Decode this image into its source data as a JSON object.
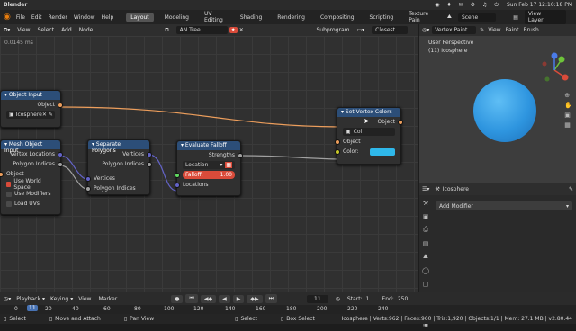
{
  "topbar": {
    "app_name": "Blender",
    "datetime": "Sun Feb 17 12:10:18 PM"
  },
  "menu": {
    "items": [
      "File",
      "Edit",
      "Render",
      "Window",
      "Help"
    ],
    "workspace_tabs": [
      "Layout",
      "Modeling",
      "UV Editing",
      "Shading",
      "Rendering",
      "Compositing",
      "Scripting",
      "Texture Pain"
    ],
    "active_tab": "Layout",
    "scene_label": "Scene",
    "view_layer_label": "View Layer"
  },
  "node_editor": {
    "header_items": [
      "View",
      "Select",
      "Add",
      "Node"
    ],
    "tree_name": "AN Tree",
    "subprogram_label": "Subprogram",
    "closest_label": "Closest",
    "timer": "0.0145 ms"
  },
  "nodes": {
    "object_input": {
      "title": "Object Input",
      "out_object": "Object",
      "object_value": "Icosphere"
    },
    "mesh_object_input": {
      "title": "Mesh Object Input",
      "out_vertex_locations": "Vertex Locations",
      "out_polygon_indices": "Polygon Indices",
      "label_object": "Object",
      "use_world_space": "Use World Space",
      "use_modifiers": "Use Modifiers",
      "load_uvs": "Load UVs"
    },
    "separate_polygons": {
      "title": "Separate Polygons",
      "out_vertices": "Vertices",
      "out_polygon_indices": "Polygon Indices",
      "in_vertices": "Vertices",
      "in_polygon_indices": "Polygon Indices"
    },
    "evaluate_falloff": {
      "title": "Evaluate Falloff",
      "out_strengths": "Strengths",
      "type_dropdown": "Location",
      "falloff_label": "Falloff:",
      "falloff_value": "1.00",
      "in_locations": "Locations"
    },
    "set_vertex_colors": {
      "title": "Set Vertex Colors",
      "out_object": "Object",
      "layer_value": "Col",
      "in_object": "Object",
      "color_label": "Color:",
      "color_hex": "#2fb8ea"
    }
  },
  "viewport": {
    "mode_label": "Vertex Paint",
    "header_items": [
      "View",
      "Paint",
      "Brush"
    ],
    "perspective": "User Perspective",
    "object_label": "(11) Icosphere",
    "sphere_color": "#2e95df"
  },
  "properties": {
    "object_name": "Icosphere",
    "add_modifier": "Add Modifier",
    "icons": [
      "tool-icon",
      "render-icon",
      "output-icon",
      "view-layer-icon",
      "scene-icon",
      "world-icon",
      "object-icon",
      "modifier-icon",
      "particles-icon",
      "physics-icon",
      "constraints-icon",
      "data-icon",
      "material-icon"
    ]
  },
  "timeline": {
    "playback": "Playback",
    "keying": "Keying",
    "view": "View",
    "marker": "Marker",
    "current_frame": "11",
    "start_label": "Start:",
    "start_value": "1",
    "end_label": "End:",
    "end_value": "250"
  },
  "ruler": {
    "ticks": [
      "0",
      "11",
      "20",
      "40",
      "60",
      "80",
      "100",
      "120",
      "140",
      "160",
      "180",
      "200",
      "220",
      "240"
    ]
  },
  "status": {
    "select": "Select",
    "move_attach": "Move and Attach",
    "pan_view": "Pan View",
    "select_short": "Select",
    "box_select": "Box Select",
    "stats": "Icosphere | Verts:962 | Faces:960 | Tris:1,920 | Objects:1/1 | Mem: 27.1 MB | v2.80.44"
  },
  "colors": {
    "node_header": "#2c4e78",
    "accent": "#4772b3",
    "sphere": "#2e95df",
    "vector_socket": "#6363c7",
    "object_socket": "#ed9e5c",
    "float_socket": "#a1a1a1",
    "color_socket": "#c7c729",
    "falloff_socket": "#5fd95f"
  }
}
